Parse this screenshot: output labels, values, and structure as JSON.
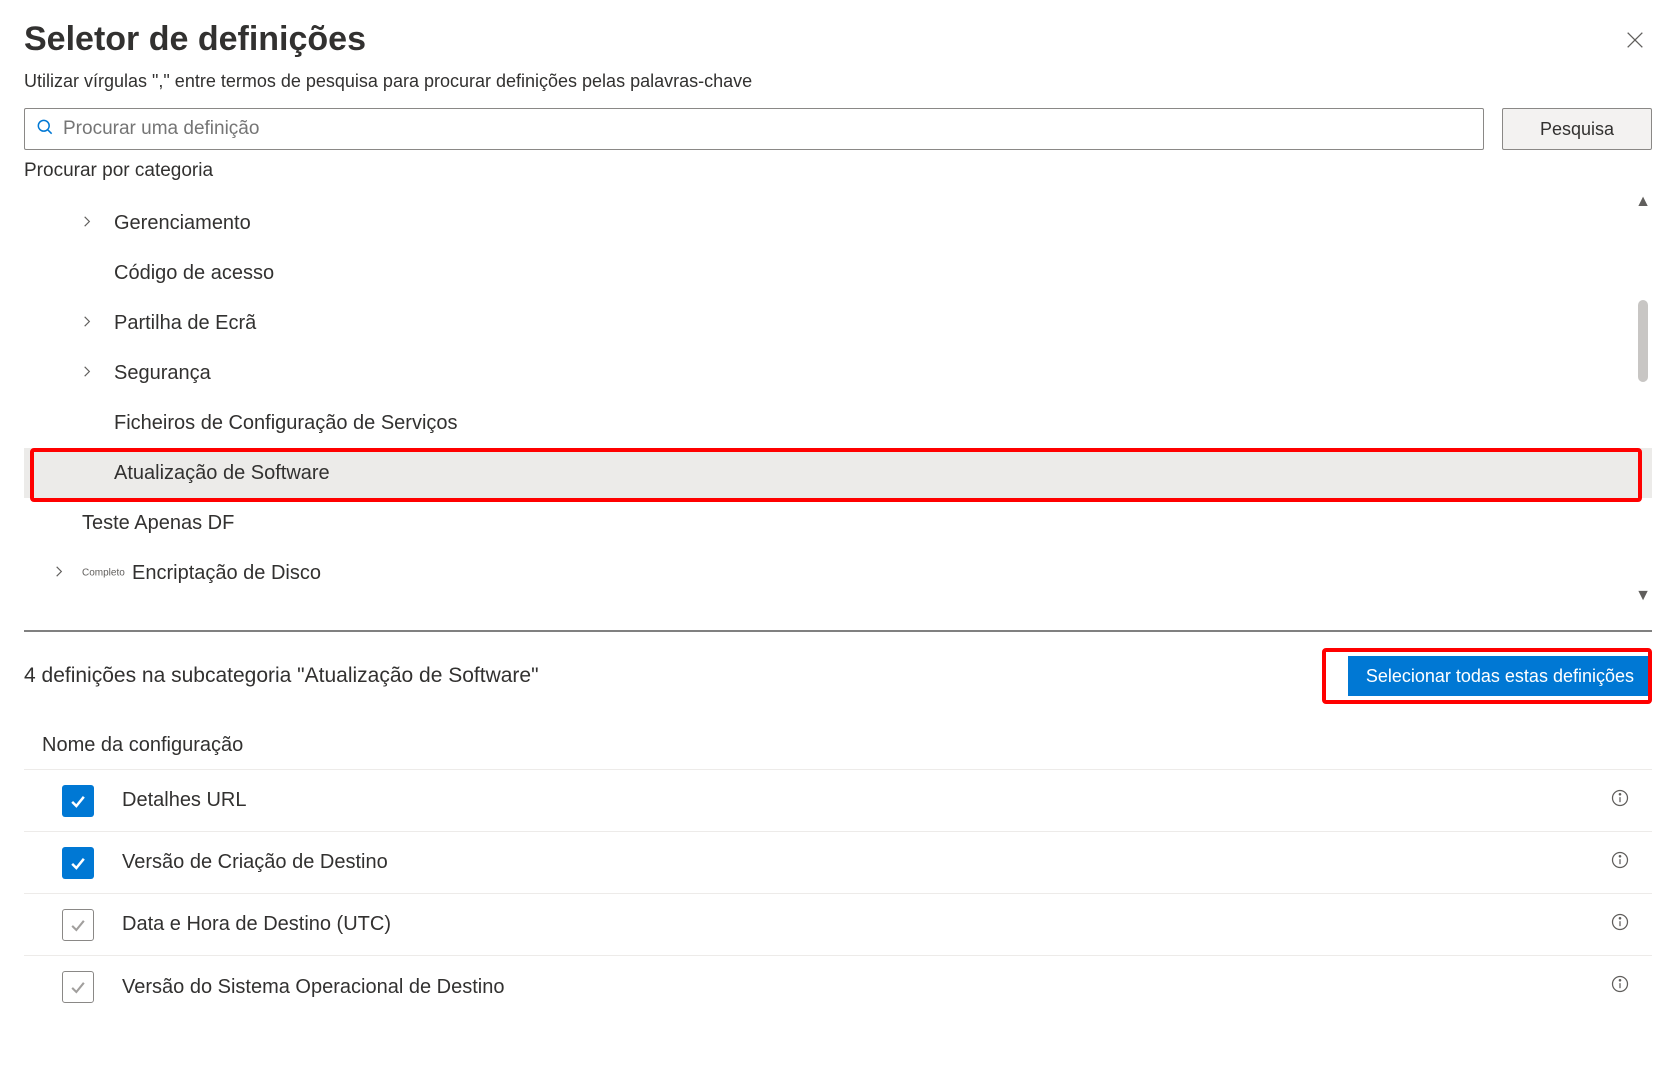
{
  "title": "Seletor de definições",
  "hint": "Utilizar vírgulas \",\" entre termos de pesquisa para procurar definições pelas palavras-chave",
  "search": {
    "placeholder": "Procurar uma definição",
    "button": "Pesquisa"
  },
  "browse_label": "Procurar por categoria",
  "categories": [
    {
      "label": "Gerenciamento",
      "expandable": true
    },
    {
      "label": "Código de acesso",
      "expandable": false
    },
    {
      "label": "Partilha de Ecrã",
      "expandable": true
    },
    {
      "label": "Segurança",
      "expandable": true
    },
    {
      "label": "Ficheiros de Configuração de Serviços",
      "expandable": false
    },
    {
      "label": "Atualização de Software",
      "expandable": false,
      "selected": true
    },
    {
      "label": "Teste Apenas DF",
      "expandable": false,
      "indent": "less"
    },
    {
      "label": "Encriptação de Disco",
      "expandable": true,
      "badge": "Completo",
      "indent": "disk"
    }
  ],
  "subcategory_line": "4 definições na subcategoria \"Atualização de Software\"",
  "select_all_label": "Selecionar todas estas definições",
  "column_header": "Nome da configuração",
  "settings": [
    {
      "name": "Detalhes URL",
      "checked": true
    },
    {
      "name": "Versão de Criação de Destino",
      "checked": true
    },
    {
      "name": "Data e Hora de Destino (UTC)",
      "checked": false
    },
    {
      "name": "Versão do Sistema Operacional de Destino",
      "checked": false
    }
  ]
}
